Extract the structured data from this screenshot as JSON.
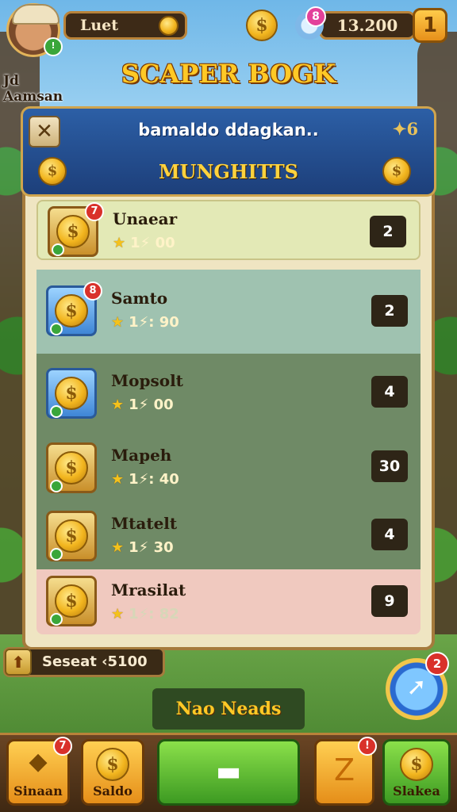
{
  "player": {
    "name": "Jd Aamsan",
    "level_badge": "!"
  },
  "top_bar": {
    "left_label": "Luet",
    "gems_badge": "8",
    "currency_value": "13.200",
    "plus_label": "1"
  },
  "title": "SCAPER BOGK",
  "panel": {
    "close_label": "✕",
    "title": "bamaldo ddagkan..",
    "count": "✦6",
    "subtitle": "MUNGHITTS"
  },
  "items": [
    {
      "name": "Unaear",
      "stat": "1⚡ 00",
      "qty": "2",
      "badge": "7"
    },
    {
      "name": "Samto",
      "stat": "1⚡: 90",
      "qty": "2",
      "badge": "8"
    },
    {
      "name": "Mopsolt",
      "stat": "1⚡ 00",
      "qty": "4",
      "badge": ""
    },
    {
      "name": "Mapeh",
      "stat": "1⚡: 40",
      "qty": "30",
      "badge": ""
    },
    {
      "name": "Mtatelt",
      "stat": "1⚡ 30",
      "qty": "4",
      "badge": ""
    },
    {
      "name": "Mrasilat",
      "stat": "1⚡: 82",
      "qty": "9",
      "badge": ""
    }
  ],
  "bonus": {
    "label": "Seseat ‹5100"
  },
  "next_button": {
    "label": "Nao Neads"
  },
  "rocket_badge": "2",
  "nav": [
    {
      "label": "Sinaan",
      "badge": "7"
    },
    {
      "label": "Saldo",
      "badge": ""
    },
    {
      "label": "",
      "badge": ""
    },
    {
      "label": "",
      "badge": "!"
    },
    {
      "label": "Slakea",
      "badge": ""
    }
  ],
  "colors": {
    "header_blue": "#2c5fa6",
    "gold": "#ffc926",
    "nav_green": "#3d9a22"
  }
}
